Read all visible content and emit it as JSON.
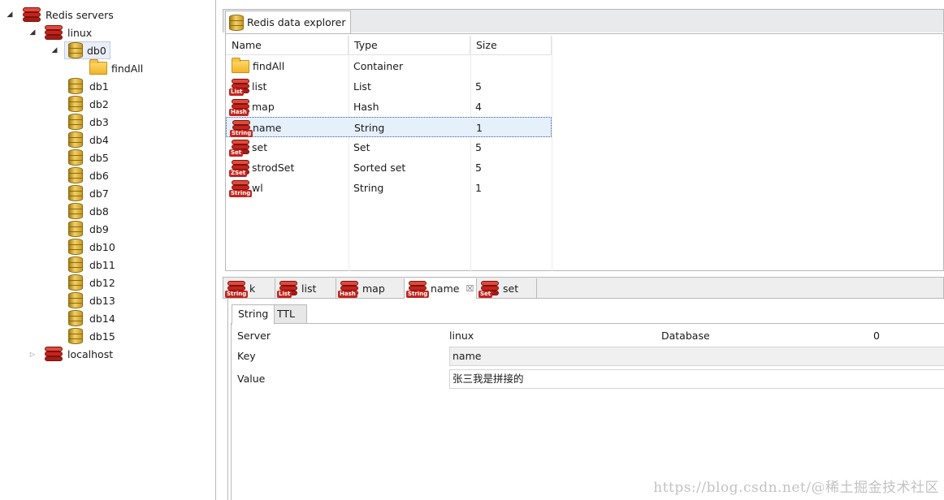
{
  "tree": {
    "root": {
      "label": "Redis servers",
      "expanded": true,
      "icon": "redis-cube-icon"
    },
    "servers": [
      {
        "label": "linux",
        "expanded": true,
        "icon": "redis-cube-icon"
      },
      {
        "label": "localhost",
        "expanded": false,
        "icon": "redis-cube-icon"
      }
    ],
    "selected_db": {
      "label": "db0",
      "expanded": true,
      "icon": "database-icon"
    },
    "db0_children": [
      {
        "label": "findAll",
        "icon": "folder-icon"
      }
    ],
    "databases": [
      "db1",
      "db2",
      "db3",
      "db4",
      "db5",
      "db6",
      "db7",
      "db8",
      "db9",
      "db10",
      "db11",
      "db12",
      "db13",
      "db14",
      "db15"
    ]
  },
  "explorer": {
    "tab_label": "Redis data explorer",
    "columns": [
      "Name",
      "Type",
      "Size"
    ],
    "rows": [
      {
        "name": "findAll",
        "type": "Container",
        "size": "",
        "icon": "folder-icon",
        "badge": ""
      },
      {
        "name": "list",
        "type": "List",
        "size": "5",
        "icon": "redis-key-icon",
        "badge": "List"
      },
      {
        "name": "map",
        "type": "Hash",
        "size": "4",
        "icon": "redis-key-icon",
        "badge": "Hash"
      },
      {
        "name": "name",
        "type": "String",
        "size": "1",
        "icon": "redis-key-icon",
        "badge": "String",
        "selected": true
      },
      {
        "name": "set",
        "type": "Set",
        "size": "5",
        "icon": "redis-key-icon",
        "badge": "Set"
      },
      {
        "name": "strodSet",
        "type": "Sorted set",
        "size": "5",
        "icon": "redis-key-icon",
        "badge": "ZSet"
      },
      {
        "name": "wl",
        "type": "String",
        "size": "1",
        "icon": "redis-key-icon",
        "badge": "String"
      }
    ]
  },
  "bottom_tabs": [
    {
      "label": "k",
      "badge": "String",
      "active": false,
      "closable": false
    },
    {
      "label": "list",
      "badge": "List",
      "active": false,
      "closable": false
    },
    {
      "label": "map",
      "badge": "Hash",
      "active": false,
      "closable": false
    },
    {
      "label": "name",
      "badge": "String",
      "active": true,
      "closable": true,
      "close_glyph": "☒"
    },
    {
      "label": "set",
      "badge": "Set",
      "active": false,
      "closable": false
    }
  ],
  "detail": {
    "tabs": [
      "String",
      "TTL"
    ],
    "active_tab": "String",
    "server_label": "Server",
    "server_value": "linux",
    "database_label": "Database",
    "database_value": "0",
    "key_label": "Key",
    "key_value": "name",
    "value_label": "Value",
    "value_value": "张三我是拼接的"
  },
  "watermark": "https://blog.csdn.net/@稀土掘金技术社区",
  "colors": {
    "redis_red": "#c4241d",
    "db_gold": "#e2b53c",
    "selection": "#e6f0fb",
    "border": "#b9b9b9"
  }
}
